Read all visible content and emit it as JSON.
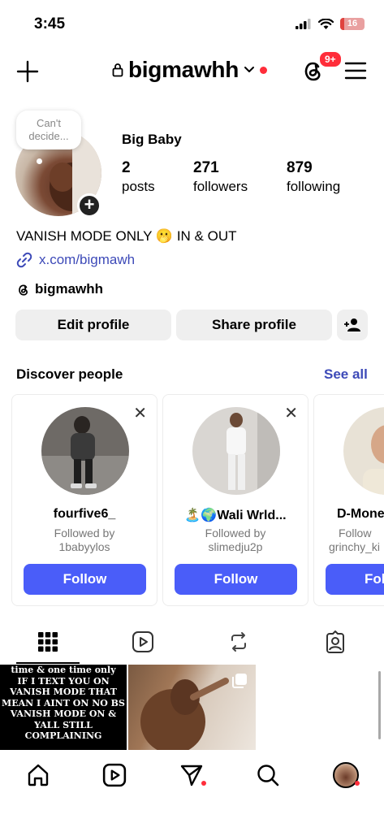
{
  "status_bar": {
    "time": "3:45",
    "battery": "16",
    "battery_fraction": 0.16
  },
  "header": {
    "username": "bigmawhh",
    "notification_badge": "9+"
  },
  "profile": {
    "note": "Can't decide...",
    "display_name": "Big Baby",
    "stats": [
      {
        "value": "2",
        "label": "posts"
      },
      {
        "value": "271",
        "label": "followers"
      },
      {
        "value": "879",
        "label": "following"
      }
    ],
    "bio": "VANISH MODE ONLY 🫢 IN & OUT",
    "link": "x.com/bigmawh",
    "threads_handle": "bigmawhh"
  },
  "actions": {
    "edit": "Edit profile",
    "share": "Share profile"
  },
  "discover": {
    "title": "Discover people",
    "see_all": "See all",
    "cards": [
      {
        "name": "fourfive6_",
        "line1": "Followed by",
        "line2": "1babyylos",
        "button": "Follow"
      },
      {
        "name": "🏝️🌍Wali Wrld...",
        "line1": "Followed by",
        "line2": "slimedju2p",
        "button": "Follow"
      },
      {
        "name": "D-Mone",
        "line1": "Follow",
        "line2": "grinchy_ki",
        "button": "Fol"
      }
    ]
  },
  "tabs": [
    "grid-icon",
    "reels-icon",
    "reposts-icon",
    "tagged-icon"
  ],
  "posts": {
    "text_post_lines": [
      "time & one time only",
      "IF I TEXT YOU ON",
      "VANISH MODE THAT",
      "MEAN I AINT ON NO BS",
      "VANISH MODE ON &",
      "YALL STILL",
      "COMPLAINING"
    ]
  },
  "colors": {
    "accent": "#4a5df9",
    "link": "#3d4ab8",
    "badge": "#ff2d3a"
  }
}
